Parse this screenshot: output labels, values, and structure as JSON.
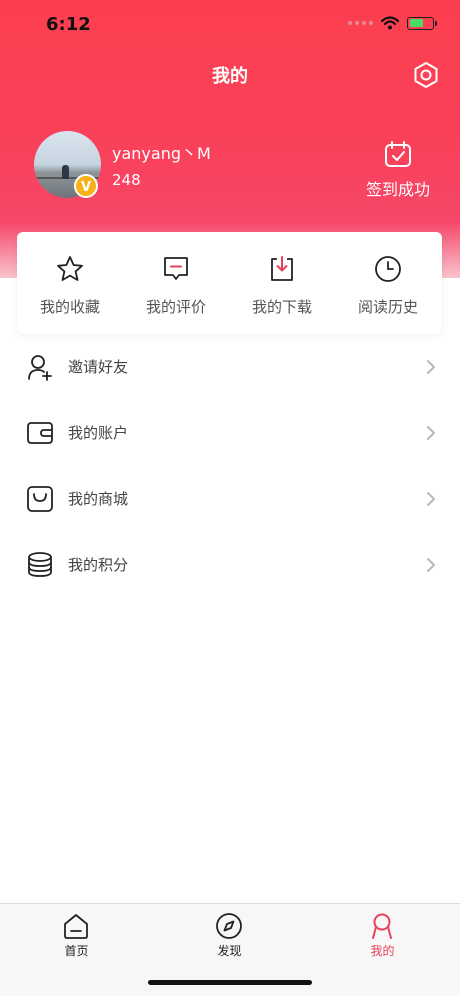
{
  "status_bar": {
    "time": "6:12",
    "battery_level": 0.6,
    "accent": "#4cd964"
  },
  "header": {
    "title": "我的",
    "settings_icon": "settings-hexagon-icon",
    "background": "#f9415b"
  },
  "profile": {
    "username": "yanyang丶M",
    "points": "248",
    "badge": "V",
    "checkin_label": "签到成功"
  },
  "quick_actions": [
    {
      "label": "我的收藏",
      "icon": "star-icon"
    },
    {
      "label": "我的评价",
      "icon": "comment-icon"
    },
    {
      "label": "我的下载",
      "icon": "download-icon"
    },
    {
      "label": "阅读历史",
      "icon": "clock-icon"
    }
  ],
  "menu": [
    {
      "label": "邀请好友",
      "icon": "add-friend-icon"
    },
    {
      "label": "我的账户",
      "icon": "wallet-icon"
    },
    {
      "label": "我的商城",
      "icon": "shopping-bag-icon"
    },
    {
      "label": "我的积分",
      "icon": "coins-icon"
    }
  ],
  "tabbar": {
    "items": [
      {
        "label": "首页",
        "icon": "home-icon"
      },
      {
        "label": "发现",
        "icon": "compass-icon"
      },
      {
        "label": "我的",
        "icon": "profile-icon"
      }
    ],
    "active_index": 2,
    "active_color": "#e8415a"
  }
}
